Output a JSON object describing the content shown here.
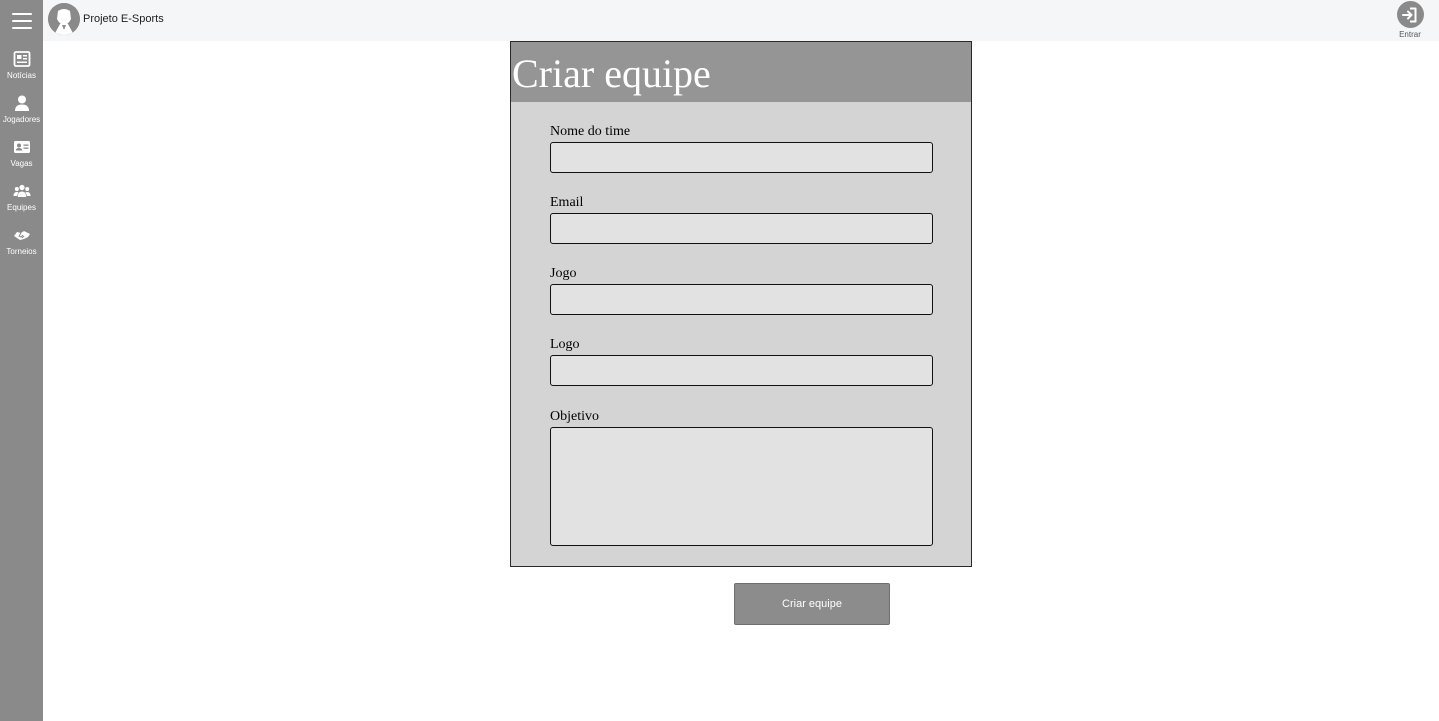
{
  "header": {
    "brand_name": "Projeto E-Sports",
    "login_label": "Entrar"
  },
  "sidebar": {
    "items": [
      {
        "label": "Notícias",
        "icon": "newspaper-icon"
      },
      {
        "label": "Jogadores",
        "icon": "user-icon"
      },
      {
        "label": "Vagas",
        "icon": "id-card-icon"
      },
      {
        "label": "Equipes",
        "icon": "users-icon"
      },
      {
        "label": "Torneios",
        "icon": "handshake-icon"
      }
    ]
  },
  "form": {
    "title": "Criar equipe",
    "fields": [
      {
        "label": "Nome do time",
        "value": ""
      },
      {
        "label": "Email",
        "value": ""
      },
      {
        "label": "Jogo",
        "value": ""
      },
      {
        "label": "Logo",
        "value": ""
      }
    ],
    "objective": {
      "label": "Objetivo",
      "value": ""
    },
    "submit_label": "Criar equipe"
  },
  "colors": {
    "sidebar": "#8a8a8a",
    "header_bg": "#f5f6f8",
    "card_bg": "#d4d4d4",
    "card_head": "#959595",
    "input_bg": "#e2e2e2",
    "button": "#8c8c8c"
  }
}
